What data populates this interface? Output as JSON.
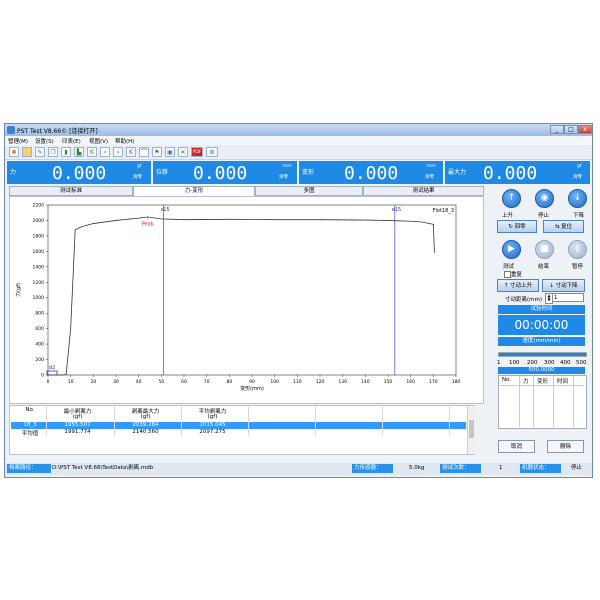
{
  "window": {
    "title": "PST Test V8.66©  [连接打开]",
    "controls": [
      "_",
      "□",
      "x"
    ]
  },
  "menu": [
    "管理(M)",
    "设置(S)",
    "印表(E)",
    "视图(V)",
    "帮助(H)"
  ],
  "toolbar_icons": [
    "tools-icon",
    "open-folder-icon",
    "edit-icon",
    "copy-icon",
    "trash-icon",
    "bookmark-icon",
    "first-icon",
    "prev-icon",
    "next-icon",
    "last-icon",
    "curve-icon",
    "flag-icon",
    "export-icon",
    "excel-icon",
    "pdf-icon",
    "settings-icon"
  ],
  "toolbar_pdf": "PDF",
  "displays": [
    {
      "label": "力",
      "value": "0.000",
      "unit": "gf",
      "zero": "清零"
    },
    {
      "label": "位移",
      "value": "0.000",
      "unit": "mm",
      "zero": "清零"
    },
    {
      "label": "变形",
      "value": "0.000",
      "unit": "mm",
      "zero": "清零"
    },
    {
      "label": "最大力",
      "value": "0.000",
      "unit": "gf",
      "zero": "清零"
    }
  ],
  "tabs": [
    "测试标准",
    "力-变形",
    "多图",
    "测试结果"
  ],
  "chart_data": {
    "type": "line",
    "xlabel": "变形(mm)",
    "ylabel": "力(gf)",
    "xlim": [
      0,
      180
    ],
    "ylim": [
      0,
      2200
    ],
    "xticks": [
      0,
      10,
      20,
      30,
      40,
      50,
      60,
      70,
      80,
      90,
      100,
      110,
      120,
      130,
      140,
      150,
      160,
      170,
      180
    ],
    "yticks": [
      0,
      200,
      400,
      600,
      800,
      1000,
      1200,
      1400,
      1600,
      1800,
      2000,
      2200
    ],
    "grid": false,
    "legend": "Flot18_3",
    "series": [
      {
        "name": "Flot18_3",
        "x": [
          0,
          5,
          8,
          10,
          12,
          15,
          20,
          30,
          40,
          44,
          50,
          60,
          80,
          100,
          120,
          140,
          150,
          160,
          165,
          170,
          170.5
        ],
        "y": [
          0,
          0,
          5,
          600,
          1880,
          1920,
          1960,
          2000,
          2030,
          2045,
          2020,
          2010,
          2015,
          2010,
          2010,
          2005,
          2000,
          1990,
          1980,
          1950,
          1580
        ]
      }
    ],
    "markers": [
      {
        "label": "s15",
        "x": 51
      },
      {
        "label": "e15",
        "x": 153
      }
    ],
    "peak": {
      "label": "Peak",
      "x": 44,
      "y": 2040
    },
    "start_marker": {
      "label": "d2",
      "x": 0,
      "y": 0
    }
  },
  "results_table": {
    "headers": [
      {
        "line1": "No.",
        "line2": ""
      },
      {
        "line1": "最小剥离力",
        "line2": "(gf)"
      },
      {
        "line1": "剥离最大力",
        "line2": "(gf)"
      },
      {
        "line1": "平均剥离力",
        "line2": "(gf)"
      }
    ],
    "rows": [
      [
        "18_3",
        "1955.507",
        "2039.284",
        "2015.045"
      ],
      [
        "平均值",
        "1991.774",
        "2140.560",
        "2097.275"
      ]
    ]
  },
  "right_panel": {
    "row1": [
      "上升",
      "停止",
      "下降"
    ],
    "return_btn": "回零",
    "reset_btn": "复位",
    "row2": [
      "测试",
      "结束",
      "暂停"
    ],
    "repeat_label": "重复",
    "jog_up": "寸动上升",
    "jog_down": "寸动下降",
    "jog_distance_label": "寸动距离(mm)",
    "jog_distance_value": "1",
    "test_time_label": "试验时间",
    "test_time": "00:00:00",
    "speed_label": "速度(mm/min)",
    "speed_ticks": [
      "1",
      "100",
      "200",
      "300",
      "400",
      "500"
    ],
    "speed_value": "500.0000",
    "speed_fraction": 0.998,
    "mini_headers": [
      "No.",
      "力",
      "变形",
      "时间"
    ],
    "cancel_btn": "取消",
    "delete_btn": "删除"
  },
  "status": {
    "path_label": "档案路径：",
    "path": "D:\\PST Test V8.66\\TestData\\剥离.mdb",
    "sensor_label": "力传感器：",
    "sensor": "5.0kg",
    "count_label": "测试次数：",
    "count": "1",
    "machine_label": "机器状态：",
    "machine": "停止"
  }
}
